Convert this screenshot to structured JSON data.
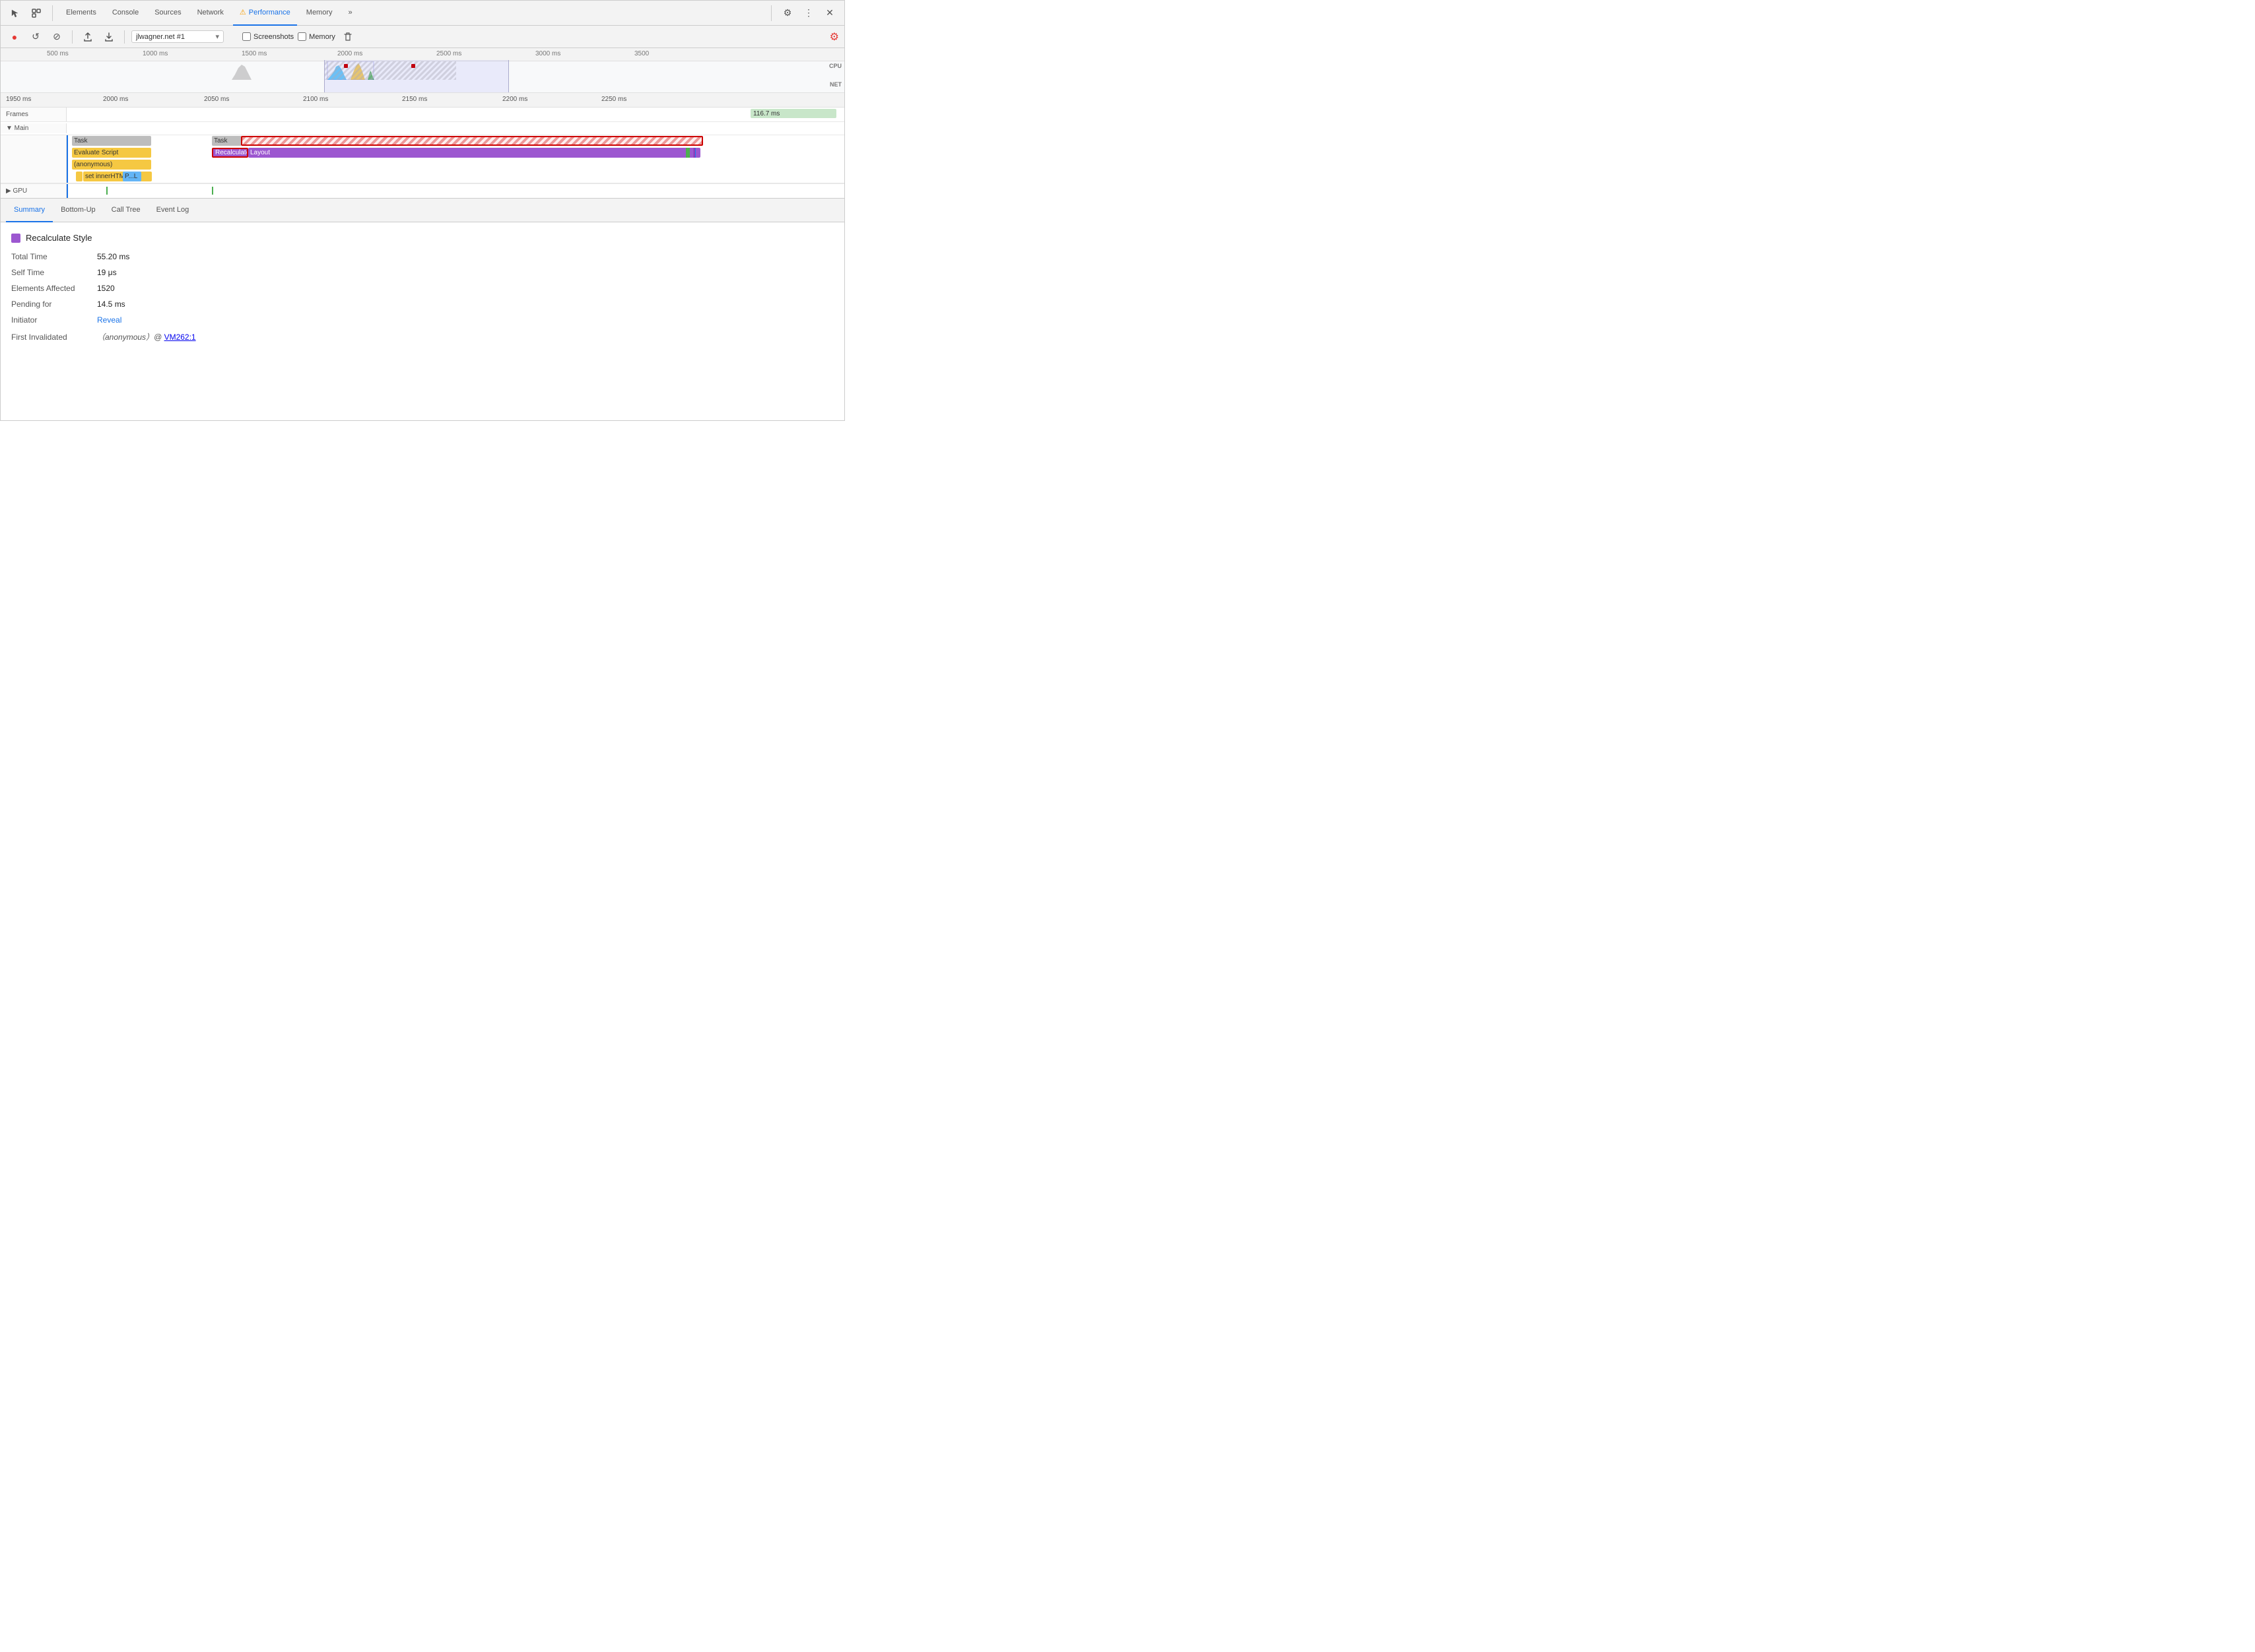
{
  "devtools": {
    "tabs": [
      {
        "id": "elements",
        "label": "Elements",
        "active": false
      },
      {
        "id": "console",
        "label": "Console",
        "active": false
      },
      {
        "id": "sources",
        "label": "Sources",
        "active": false
      },
      {
        "id": "network",
        "label": "Network",
        "active": false
      },
      {
        "id": "performance",
        "label": "Performance",
        "active": true,
        "warn": true
      },
      {
        "id": "memory",
        "label": "Memory",
        "active": false
      },
      {
        "id": "more",
        "label": "»",
        "active": false
      }
    ],
    "toolbar": {
      "record_label": "●",
      "reload_label": "↺",
      "clear_label": "⊘",
      "upload_label": "↑",
      "download_label": "↓",
      "url_value": "jlwagner.net #1",
      "screenshots_label": "Screenshots",
      "memory_label": "Memory"
    },
    "icons": {
      "cursor": "⬡",
      "box": "▣",
      "gear": "⚙",
      "more": "⋮",
      "close": "✕",
      "gear_red": "⚙"
    }
  },
  "overview": {
    "ticks": [
      "500 ms",
      "1000 ms",
      "1500 ms",
      "2000 ms",
      "2500 ms",
      "3000 ms",
      "3500"
    ],
    "cpu_label": "CPU",
    "net_label": "NET"
  },
  "detail_ruler": {
    "ticks": [
      "1950 ms",
      "2000 ms",
      "2050 ms",
      "2100 ms",
      "2150 ms",
      "2200 ms",
      "2250 ms"
    ]
  },
  "timeline": {
    "frames_label": "Frames",
    "frames_value": "116.7 ms",
    "main_label": "▼ Main",
    "gpu_label": "▶ GPU",
    "rows": [
      {
        "level": 0,
        "bars": [
          {
            "label": "Task",
            "color": "#e8e8e8",
            "text_color": "#333",
            "left_pct": 5,
            "width_pct": 13,
            "border": "none"
          },
          {
            "label": "Task",
            "color": "#e8e8e8",
            "text_color": "#333",
            "left_pct": 20,
            "width_pct": 4,
            "border": "none"
          },
          {
            "label": "",
            "color": "hatch-red",
            "text_color": "transparent",
            "left_pct": 24,
            "width_pct": 62,
            "border": "2px solid #c00",
            "is_hatch": true
          }
        ]
      },
      {
        "level": 1,
        "bars": [
          {
            "label": "Evaluate Script",
            "color": "#f5c842",
            "text_color": "#333",
            "left_pct": 5,
            "width_pct": 13
          },
          {
            "label": "Recalculate Style",
            "color": "#9c57d0",
            "text_color": "white",
            "left_pct": 20,
            "width_pct": 5,
            "border": "2px solid #c00"
          },
          {
            "label": "Layout",
            "color": "#9c57d0",
            "text_color": "white",
            "left_pct": 25.5,
            "width_pct": 53
          }
        ]
      },
      {
        "level": 2,
        "bars": [
          {
            "label": "(anonymous)",
            "color": "#f5c842",
            "text_color": "#333",
            "left_pct": 5,
            "width_pct": 13
          }
        ]
      },
      {
        "level": 3,
        "bars": [
          {
            "label": "set innerHTML",
            "color": "#f5c842",
            "text_color": "#333",
            "left_pct": 5.5,
            "width_pct": 10
          },
          {
            "label": "P...L",
            "color": "#64b5f6",
            "text_color": "#333",
            "left_pct": 11,
            "width_pct": 2.8
          },
          {
            "label": "",
            "color": "#f5c842",
            "text_color": "#333",
            "left_pct": 13.8,
            "width_pct": 1.5
          }
        ]
      }
    ]
  },
  "bottom_panel": {
    "tabs": [
      {
        "id": "summary",
        "label": "Summary",
        "active": true
      },
      {
        "id": "bottom-up",
        "label": "Bottom-Up",
        "active": false
      },
      {
        "id": "call-tree",
        "label": "Call Tree",
        "active": false
      },
      {
        "id": "event-log",
        "label": "Event Log",
        "active": false
      }
    ],
    "summary": {
      "title": "Recalculate Style",
      "color": "#9c57d0",
      "rows": [
        {
          "key": "Total Time",
          "value": "55.20 ms"
        },
        {
          "key": "Self Time",
          "value": "19 μs"
        },
        {
          "key": "Elements Affected",
          "value": "1520"
        },
        {
          "key": "Pending for",
          "value": "14.5 ms"
        },
        {
          "key": "Initiator",
          "value_link": "Reveal",
          "value_link_href": "#"
        },
        {
          "key": "First Invalidated",
          "value_italic": "(anonymous）@ ",
          "value_link": "VM262:1",
          "value_link_href": "#"
        }
      ]
    }
  }
}
